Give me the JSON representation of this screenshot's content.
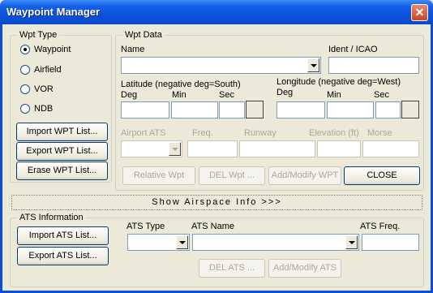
{
  "window": {
    "title": "Waypoint Manager",
    "close_symbol": "✕"
  },
  "wpt_type": {
    "legend": "Wpt Type",
    "options": [
      "Waypoint",
      "Airfield",
      "VOR",
      "NDB"
    ],
    "selected": "Waypoint",
    "import_label": "Import WPT List...",
    "export_label": "Export WPT List...",
    "erase_label": "Erase WPT List..."
  },
  "wpt_data": {
    "legend": "Wpt Data",
    "name_label": "Name",
    "name_value": "",
    "ident_label": "Ident / ICAO",
    "ident_value": "",
    "latitude_label": "Latitude (negative deg=South)",
    "longitude_label": "Longitude (negative deg=West)",
    "deg_label": "Deg",
    "min_label": "Min",
    "sec_label": "Sec",
    "airport_ats_label": "Airport ATS",
    "freq_label": "Freq.",
    "runway_label": "Runway",
    "elevation_label": "Elevation (ft)",
    "morse_label": "Morse",
    "relative_label": "Relative Wpt",
    "del_label": "DEL Wpt ...",
    "addmod_label": "Add/Modify WPT",
    "close_label": "CLOSE"
  },
  "airspace": {
    "label": "Show Airspace Info >>>"
  },
  "ats_info": {
    "legend": "ATS Information",
    "import_label": "Import ATS List...",
    "export_label": "Export ATS List...",
    "type_label": "ATS Type",
    "name_label": "ATS Name",
    "freq_label": "ATS Freq.",
    "del_label": "DEL ATS ...",
    "addmod_label": "Add/Modify ATS"
  }
}
